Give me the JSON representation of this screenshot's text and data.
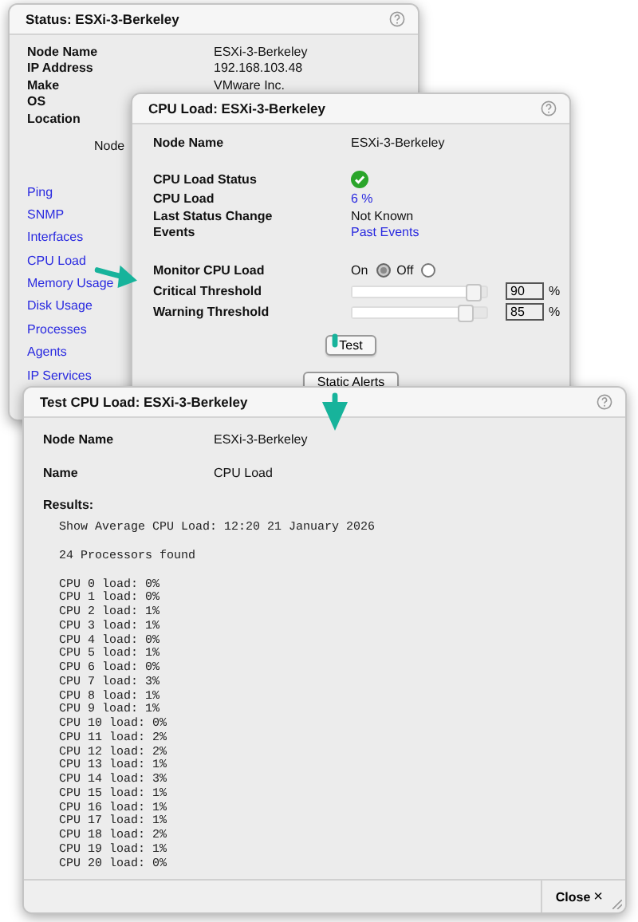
{
  "status_window": {
    "title": "Status: ESXi-3-Berkeley",
    "fields": [
      {
        "label": "Node Name",
        "value": "ESXi-3-Berkeley"
      },
      {
        "label": "IP Address",
        "value": "192.168.103.48"
      },
      {
        "label": "Make",
        "value": "VMware Inc."
      },
      {
        "label": "OS"
      },
      {
        "label": "Location"
      }
    ],
    "partial_text": "Node",
    "links": [
      "Ping",
      "SNMP",
      "Interfaces",
      "CPU Load",
      "Memory Usage",
      "Disk Usage",
      "Processes",
      "Agents",
      "IP Services"
    ]
  },
  "cpu_window": {
    "title": "CPU Load: ESXi-3-Berkeley",
    "node": {
      "label": "Node Name",
      "value": "ESXi-3-Berkeley"
    },
    "status_fields": [
      {
        "label": "CPU Load Status",
        "kind": "status"
      },
      {
        "label": "CPU Load",
        "kind": "link",
        "value": "6 %"
      },
      {
        "label": "Last Status Change",
        "kind": "text",
        "value": "Not Known"
      },
      {
        "label": "Events",
        "kind": "link",
        "value": "Past Events"
      }
    ],
    "monitor": {
      "label": "Monitor CPU Load",
      "options": [
        {
          "label": "On",
          "selected": true
        },
        {
          "label": "Off",
          "selected": false
        }
      ]
    },
    "thresholds": [
      {
        "label": "Critical Threshold",
        "level": 0.9,
        "value": "90",
        "unit": "%"
      },
      {
        "label": "Warning Threshold",
        "level": 0.85,
        "value": "85",
        "unit": "%"
      }
    ],
    "buttons": [
      "Test",
      "Static Alerts"
    ]
  },
  "test_window": {
    "title": "Test CPU Load: ESXi-3-Berkeley",
    "fields": [
      {
        "label": "Node Name",
        "value": "ESXi-3-Berkeley"
      },
      {
        "label": "Name",
        "value": "CPU Load"
      }
    ],
    "results_label": "Results:",
    "results": [
      "Show Average CPU Load: 12:20 21 January 2026",
      "24 Processors found"
    ],
    "cpu_lines": [
      "CPU 0 load: 0%",
      "CPU 1 load: 0%",
      "CPU 2 load: 1%",
      "CPU 3 load: 1%",
      "CPU 4 load: 0%",
      "CPU 5 load: 1%",
      "CPU 6 load: 0%",
      "CPU 7 load: 3%",
      "CPU 8 load: 1%",
      "CPU 9 load: 1%",
      "CPU 10 load: 0%",
      "CPU 11 load: 2%",
      "CPU 12 load: 2%",
      "CPU 13 load: 1%",
      "CPU 14 load: 3%",
      "CPU 15 load: 1%",
      "CPU 16 load: 1%",
      "CPU 17 load: 1%",
      "CPU 18 load: 2%",
      "CPU 19 load: 1%",
      "CPU 20 load: 0%"
    ],
    "close_button": {
      "label": "Close",
      "icon": "×"
    }
  }
}
